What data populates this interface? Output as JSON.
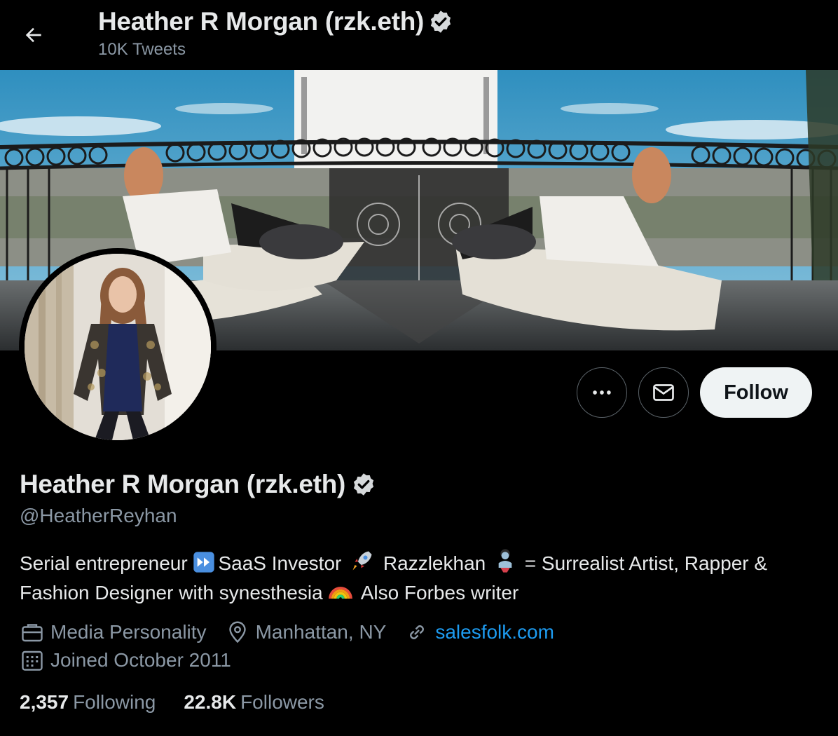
{
  "header": {
    "title": "Heather R Morgan (rzk.eth)",
    "tweet_count": "10K Tweets"
  },
  "profile": {
    "name": "Heather R Morgan (rzk.eth)",
    "handle": "@HeatherReyhan",
    "bio": {
      "part1": "Serial entrepreneur ",
      "part2": "SaaS Investor ",
      "part3": " Razzlekhan ",
      "part4": " = Surrealist Artist, Rapper & Fashion Designer with synesthesia ",
      "part5": " Also Forbes writer"
    },
    "category": "Media Personality",
    "location": "Manhattan, NY",
    "website": "salesfolk.com",
    "joined": "Joined October 2011"
  },
  "actions": {
    "follow_label": "Follow"
  },
  "stats": {
    "following_count": "2,357",
    "following_label": "Following",
    "followers_count": "22.8K",
    "followers_label": "Followers"
  },
  "icons": {
    "back": "arrow-left-icon",
    "verified": "verified-badge-icon",
    "more": "more-horizontal-icon",
    "message": "envelope-icon",
    "category": "briefcase-icon",
    "location": "map-pin-icon",
    "website": "link-icon",
    "joined": "calendar-icon"
  },
  "colors": {
    "background": "#000000",
    "text_primary": "#e7e9ea",
    "text_secondary": "#8b98a5",
    "link": "#1d9bf0",
    "follow_button_bg": "#eff3f4"
  }
}
